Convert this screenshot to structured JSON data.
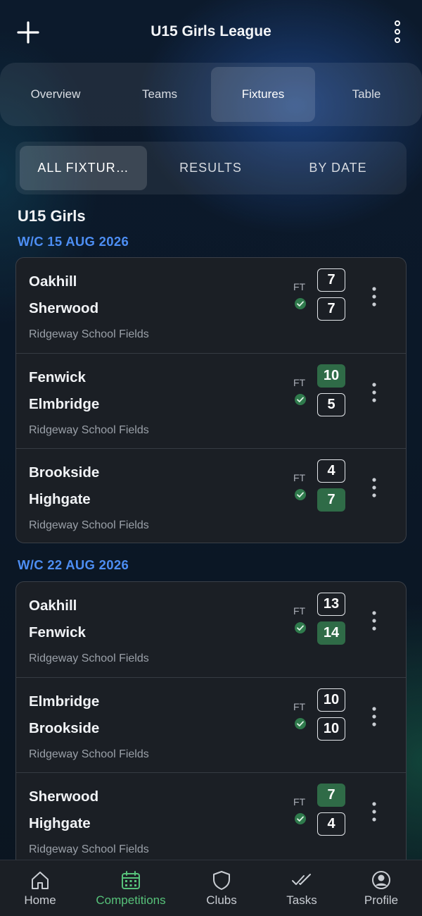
{
  "header": {
    "title": "U15 Girls League",
    "add_icon": "plus-icon",
    "menu_icon": "more-vertical-icon"
  },
  "tabs": [
    {
      "label": "Overview",
      "active": false
    },
    {
      "label": "Teams",
      "active": false
    },
    {
      "label": "Fixtures",
      "active": true
    },
    {
      "label": "Table",
      "active": false
    }
  ],
  "segments": [
    {
      "label": "ALL FIXTUR…",
      "active": true
    },
    {
      "label": "RESULTS",
      "active": false
    },
    {
      "label": "BY DATE",
      "active": false
    }
  ],
  "group_title": "U15 Girls",
  "weeks": [
    {
      "label": "W/C 15 AUG 2026",
      "fixtures": [
        {
          "home": "Oakhill",
          "away": "Sherwood",
          "venue": "Ridgeway School Fields",
          "status": "FT",
          "home_score": "7",
          "away_score": "7",
          "winner": "none"
        },
        {
          "home": "Fenwick",
          "away": "Elmbridge",
          "venue": "Ridgeway School Fields",
          "status": "FT",
          "home_score": "10",
          "away_score": "5",
          "winner": "home"
        },
        {
          "home": "Brookside",
          "away": "Highgate",
          "venue": "Ridgeway School Fields",
          "status": "FT",
          "home_score": "4",
          "away_score": "7",
          "winner": "away"
        }
      ]
    },
    {
      "label": "W/C 22 AUG 2026",
      "fixtures": [
        {
          "home": "Oakhill",
          "away": "Fenwick",
          "venue": "Ridgeway School Fields",
          "status": "FT",
          "home_score": "13",
          "away_score": "14",
          "winner": "away"
        },
        {
          "home": "Elmbridge",
          "away": "Brookside",
          "venue": "Ridgeway School Fields",
          "status": "FT",
          "home_score": "10",
          "away_score": "10",
          "winner": "none"
        },
        {
          "home": "Sherwood",
          "away": "Highgate",
          "venue": "Ridgeway School Fields",
          "status": "FT",
          "home_score": "7",
          "away_score": "4",
          "winner": "home"
        }
      ]
    }
  ],
  "bottom_nav": [
    {
      "label": "Home",
      "icon": "home-icon",
      "active": false
    },
    {
      "label": "Competitions",
      "icon": "calendar-icon",
      "active": true
    },
    {
      "label": "Clubs",
      "icon": "shield-icon",
      "active": false
    },
    {
      "label": "Tasks",
      "icon": "double-check-icon",
      "active": false
    },
    {
      "label": "Profile",
      "icon": "profile-icon",
      "active": false
    }
  ],
  "colors": {
    "accent_blue": "#4d8ef3",
    "win_green": "#2f6b47",
    "nav_active": "#57c27a",
    "card_bg": "#1b1f25"
  }
}
